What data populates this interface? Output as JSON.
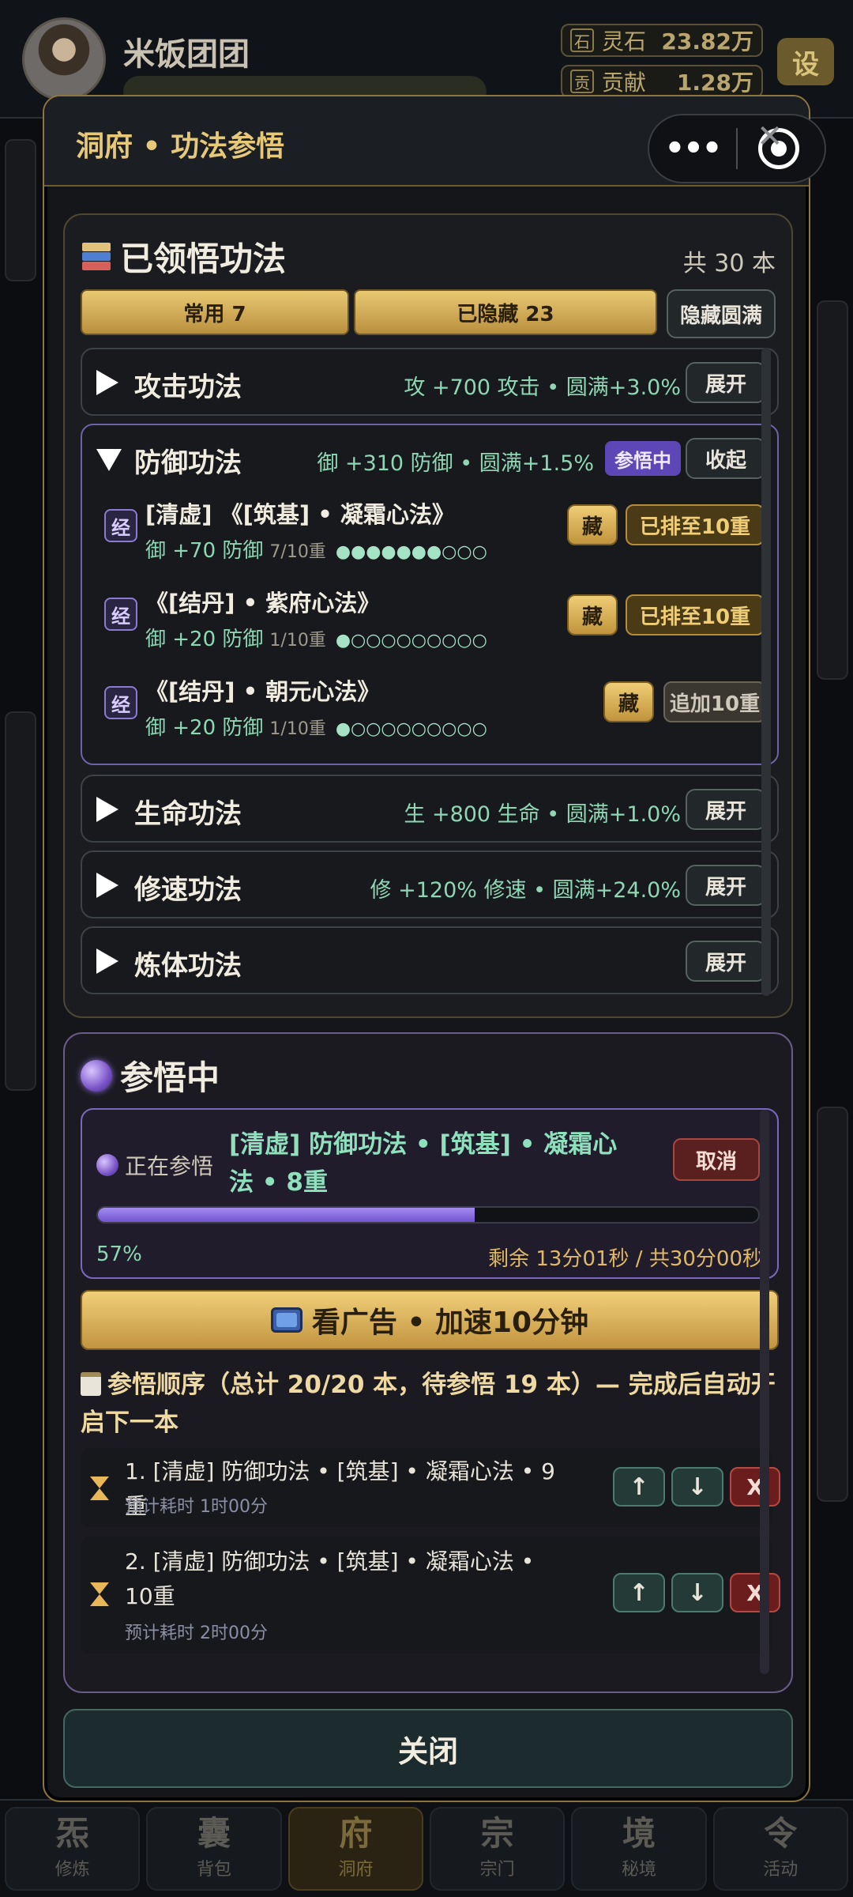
{
  "background": {
    "player_name": "米饭团团",
    "resources": [
      {
        "icon": "石",
        "label": "灵石",
        "value": "23.82万"
      },
      {
        "icon": "贡",
        "label": "贡献",
        "value": "1.28万"
      }
    ],
    "settings_label": "设",
    "nav": [
      {
        "glyph": "炁",
        "label": "修炼"
      },
      {
        "glyph": "囊",
        "label": "背包"
      },
      {
        "glyph": "府",
        "label": "洞府"
      },
      {
        "glyph": "宗",
        "label": "宗门"
      },
      {
        "glyph": "境",
        "label": "秘境"
      },
      {
        "glyph": "令",
        "label": "活动"
      }
    ]
  },
  "modal": {
    "title": "洞府 • 功法参悟",
    "capsule": {
      "more": "•••",
      "close": "✕"
    }
  },
  "learned": {
    "title": "已领悟功法",
    "total": "共 30 本",
    "tabs": {
      "common": "常用 7",
      "hidden": "已隐藏 23",
      "hide_full": "隐藏圆满"
    },
    "categories": [
      {
        "name": "攻击功法",
        "stat": "攻 +700 攻击 • 圆满+3.0%",
        "action": "展开"
      },
      {
        "name": "防御功法",
        "stat": "御 +310 防御 • 圆满+1.5%",
        "badge": "参悟中",
        "action": "收起",
        "techniques": [
          {
            "icon": "经",
            "name": "[清虚] 《[筑基] • 凝霜心法》",
            "bonus": "御 +70 防御",
            "level": "7/10重",
            "progress": 7,
            "max": 10,
            "hide": "藏",
            "action": "已排至10重"
          },
          {
            "icon": "经",
            "name": "《[结丹] • 紫府心法》",
            "bonus": "御 +20 防御",
            "level": "1/10重",
            "progress": 1,
            "max": 10,
            "hide": "藏",
            "action": "已排至10重"
          },
          {
            "icon": "经",
            "name": "《[结丹] • 朝元心法》",
            "bonus": "御 +20 防御",
            "level": "1/10重",
            "progress": 1,
            "max": 10,
            "hide": "藏",
            "action": "追加10重"
          }
        ]
      },
      {
        "name": "生命功法",
        "stat": "生 +800 生命 • 圆满+1.0%",
        "action": "展开"
      },
      {
        "name": "修速功法",
        "stat": "修 +120% 修速 • 圆满+24.0%",
        "action": "展开"
      },
      {
        "name": "炼体功法",
        "stat": "",
        "action": "展开"
      }
    ]
  },
  "comprehending": {
    "title": "参悟中",
    "current": {
      "label": "正在参悟",
      "name": "[清虚] 防御功法 • [筑基] • 凝霜心法 • 8重",
      "cancel": "取消",
      "progress": 0.57,
      "percent": "57%",
      "remaining": "剩余 13分01秒 / 共30分00秒"
    },
    "ad_button": "看广告 • 加速10分钟",
    "queue_title": "参悟顺序（总计 20/20 本，待参悟 19 本）— 完成后自动开启下一本",
    "queue": [
      {
        "name": "1. [清虚] 防御功法 • [筑基] • 凝霜心法 • 9重",
        "estimate": "预计耗时 1时00分",
        "up": "↑",
        "down": "↓",
        "remove": "X"
      },
      {
        "name": "2. [清虚] 防御功法 • [筑基] • 凝霜心法 • 10重",
        "estimate": "预计耗时 2时00分",
        "up": "↑",
        "down": "↓",
        "remove": "X"
      }
    ]
  },
  "close_button": "关闭",
  "colors": {
    "gold": "#e5c979",
    "green_stat": "#8fd7b4",
    "purple": "#7254d0",
    "progress_fill": "#8a6ee0"
  }
}
